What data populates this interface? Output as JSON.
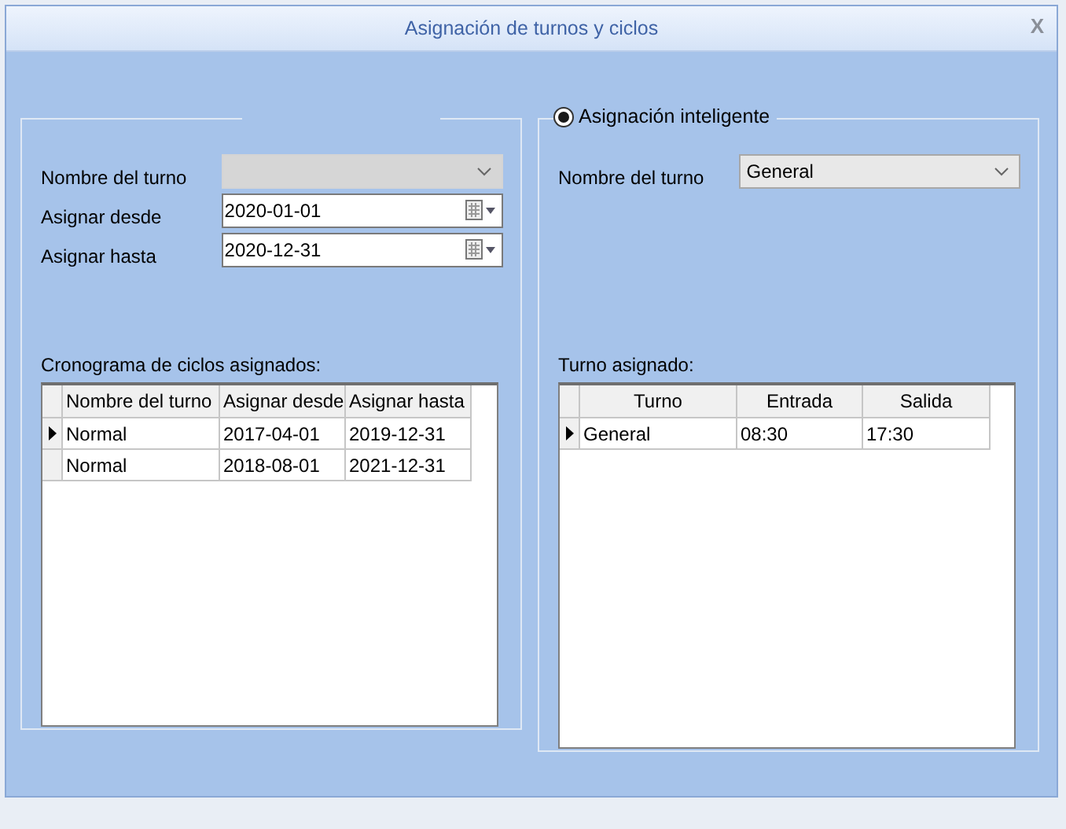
{
  "window": {
    "title": "Asignación de turnos y ciclos",
    "close": "X"
  },
  "left_panel": {
    "fields": [
      {
        "kind": "combo",
        "label": "Nombre del turno",
        "disabled": true
      },
      {
        "kind": "date",
        "label": "Asignar desde",
        "value": "2020-01-01",
        "disabled": false
      },
      {
        "kind": "date",
        "label": "Asignar hasta",
        "value": "2020-12-31",
        "disabled": false
      }
    ],
    "grid_title": "Cronograma de ciclos asignados:",
    "grid": {
      "columns": [
        "Nombre del turno",
        "Asignar desde",
        "Asignar hasta"
      ],
      "rows": [
        {
          "cells": [
            "Normal",
            "2017-04-01",
            "2019-12-31"
          ],
          "selected": true
        },
        {
          "cells": [
            "Normal",
            "2018-08-01",
            "2021-12-31"
          ],
          "selected": false
        }
      ]
    }
  },
  "right_panel": {
    "radio": {
      "label": "Asignación inteligente",
      "selected": true
    },
    "fields": [
      {
        "kind": "combo",
        "label": "Nombre del turno",
        "value": "General",
        "disabled": false
      }
    ],
    "grid_title": "Turno asignado:",
    "grid": {
      "columns": [
        "Turno",
        "Entrada",
        "Salida"
      ],
      "rows": [
        {
          "cells": [
            "General",
            "08:30",
            "17:30"
          ],
          "selected": true
        }
      ]
    }
  }
}
